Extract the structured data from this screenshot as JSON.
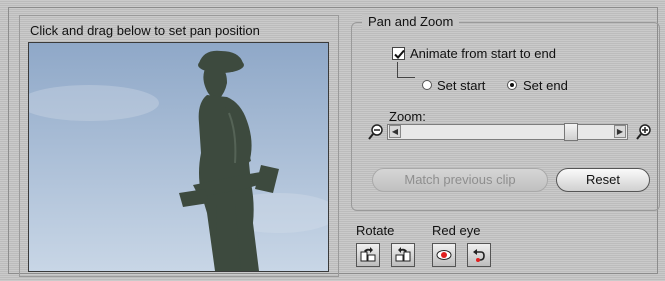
{
  "left_panel": {
    "title": "Click and drag below to set pan position"
  },
  "pan_zoom": {
    "legend": "Pan and Zoom",
    "animate_checkbox": {
      "label": "Animate from start to end",
      "checked": true
    },
    "radios": [
      {
        "label": "Set start",
        "selected": false
      },
      {
        "label": "Set end",
        "selected": true
      }
    ],
    "zoom": {
      "label": "Zoom:",
      "value": 0.82
    },
    "buttons": {
      "match_previous": "Match previous clip",
      "reset": "Reset"
    }
  },
  "tools": {
    "rotate_label": "Rotate",
    "red_eye_label": "Red eye",
    "icons": [
      "rotate-left-icon",
      "rotate-right-icon",
      "red-eye-icon",
      "undo-icon"
    ]
  },
  "colors": {
    "sky_top": "#8fa8c8",
    "sky_bottom": "#c8d6e6",
    "statue": "#3d4a3e",
    "red_eye": "#e02020"
  }
}
